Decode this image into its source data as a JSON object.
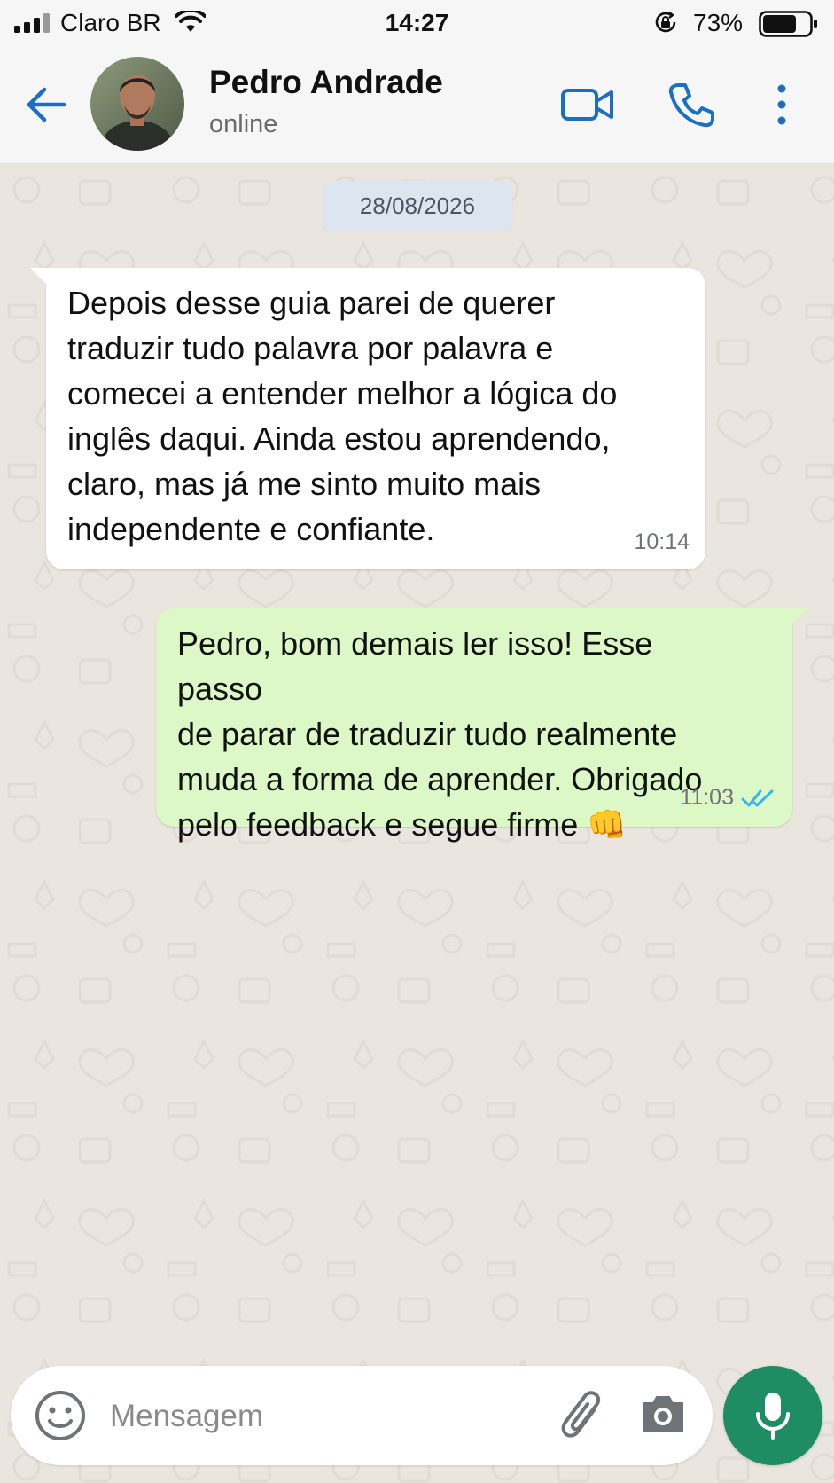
{
  "status_bar": {
    "carrier": "Claro BR",
    "time": "14:27",
    "battery_percent": "73%",
    "battery_level": 0.73,
    "icons": [
      "signal-icon",
      "wifi-icon",
      "orientation-lock-icon",
      "battery-icon"
    ]
  },
  "header": {
    "contact_name": "Pedro Andrade",
    "contact_status": "online",
    "icons": [
      "back-arrow-icon",
      "video-call-icon",
      "phone-icon",
      "more-vertical-icon"
    ]
  },
  "chat": {
    "date_separator": "28/08/2026",
    "messages": [
      {
        "direction": "incoming",
        "text": "Depois desse guia parei de querer\ntraduzir tudo palavra por palavra e\ncomecei a entender melhor a lógica do\ninglês daqui. Ainda estou aprendendo,\nclaro, mas já me sinto muito mais\nindependente e confiante.",
        "time": "10:14"
      },
      {
        "direction": "outgoing",
        "text": "Pedro, bom demais ler isso! Esse passo\nde parar de traduzir tudo realmente\nmuda a forma de aprender. Obrigado\npelo feedback e segue firme 👊",
        "time": "11:03",
        "status": "read"
      }
    ]
  },
  "composer": {
    "placeholder": "Mensagem",
    "value": "",
    "icons": [
      "emoji-icon",
      "paperclip-icon",
      "camera-icon",
      "microphone-icon"
    ]
  },
  "colors": {
    "accent_blue": "#1B6EC2",
    "outgoing_bubble": "#DCF8C6",
    "incoming_bubble": "#FFFFFF",
    "chat_background": "#EAE6DF",
    "mic_button": "#1E8D63",
    "read_ticks": "#34B7F1"
  }
}
